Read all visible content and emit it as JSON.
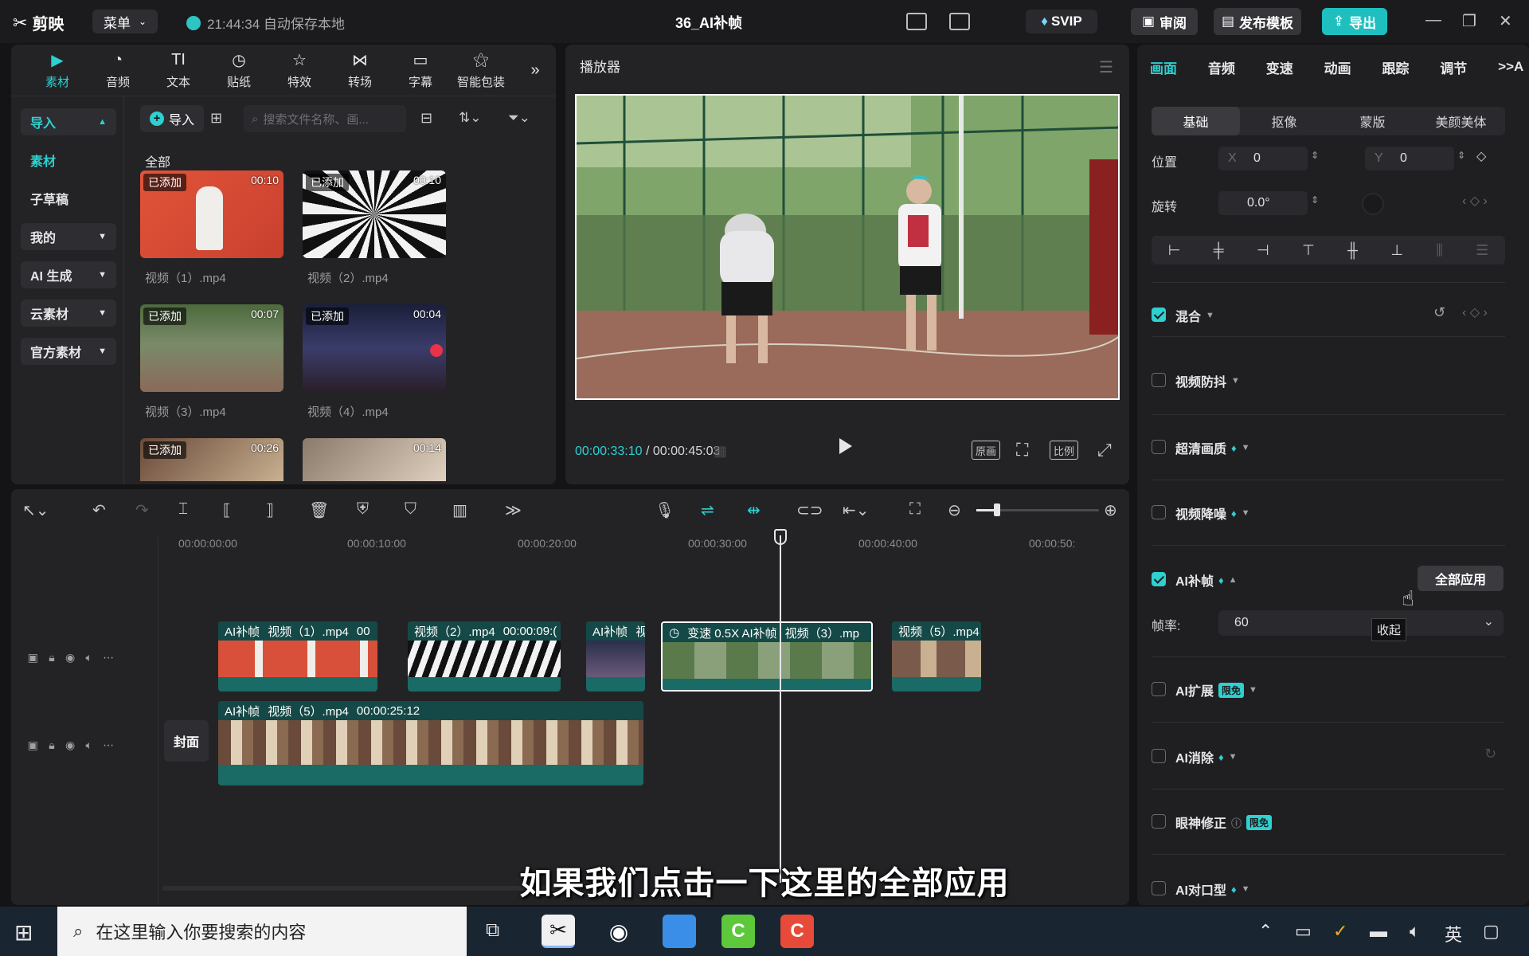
{
  "titlebar": {
    "app_name": "剪映",
    "menu_label": "菜单",
    "autosave_text": "21:44:34 自动保存本地",
    "doc_title": "36_AI补帧",
    "svip_label": "SVIP",
    "review_label": "审阅",
    "publish_label": "发布模板",
    "export_label": "导出"
  },
  "media": {
    "tabs": [
      {
        "label": "素材",
        "icon": "media-icon"
      },
      {
        "label": "音频",
        "icon": "audio-icon"
      },
      {
        "label": "文本",
        "icon": "text-icon"
      },
      {
        "label": "贴纸",
        "icon": "sticker-icon"
      },
      {
        "label": "特效",
        "icon": "effects-icon"
      },
      {
        "label": "转场",
        "icon": "transition-icon"
      },
      {
        "label": "字幕",
        "icon": "subtitle-icon"
      },
      {
        "label": "智能包装",
        "icon": "smart-pack-icon"
      }
    ],
    "nav": {
      "import": "导入",
      "material": "素材",
      "subdraft": "子草稿",
      "mine": "我的",
      "ai_gen": "AI 生成",
      "cloud": "云素材",
      "official": "官方素材"
    },
    "import_button": "导入",
    "search_placeholder": "搜索文件名称、画...",
    "all_label": "全部",
    "added_label": "已添加",
    "items": [
      {
        "name": "视频（1）.mp4",
        "duration": "00:10"
      },
      {
        "name": "视频（2）.mp4",
        "duration": "00:10"
      },
      {
        "name": "视频（3）.mp4",
        "duration": "00:07"
      },
      {
        "name": "视频（4）.mp4",
        "duration": "00:04"
      },
      {
        "name": "",
        "duration": "00:26"
      },
      {
        "name": "",
        "duration": "00:14"
      }
    ]
  },
  "player": {
    "title": "播放器",
    "current_time": "00:00:33:10",
    "total_time": "00:00:45:03",
    "original_label": "原画",
    "ratio_label": "比例"
  },
  "props": {
    "tabs": [
      "画面",
      "音频",
      "变速",
      "动画",
      "跟踪",
      "调节"
    ],
    "subtabs": [
      "基础",
      "抠像",
      "蒙版",
      "美颜美体"
    ],
    "position_label": "位置",
    "x_label": "X",
    "x_value": "0",
    "y_label": "Y",
    "y_value": "0",
    "rotate_label": "旋转",
    "rotate_value": "0.0°",
    "blend_label": "混合",
    "stabilize_label": "视频防抖",
    "hd_label": "超清画质",
    "denoise_label": "视频降噪",
    "ai_frame_label": "AI补帧",
    "apply_all_label": "全部应用",
    "fps_label": "帧率:",
    "fps_value": "60",
    "collapse_tooltip": "收起",
    "ai_expand_label": "AI扩展",
    "free_badge": "限免",
    "ai_erase_label": "AI消除",
    "eye_fix_label": "眼神修正",
    "ai_lip_label": "AI对口型",
    "accent_color": "#2ed0d0"
  },
  "timeline": {
    "ruler": [
      "00:00:00:00",
      "00:00:10:00",
      "00:00:20:00",
      "00:00:30:00",
      "00:00:40:00",
      "00:00:50:"
    ],
    "cover_label": "封面",
    "track1": [
      {
        "tag": "AI补帧",
        "name": "视频（1）.mp4",
        "dur": "00"
      },
      {
        "tag": "",
        "name": "视频（2）.mp4",
        "dur": "00:00:09:("
      },
      {
        "tag": "AI补帧",
        "name": "视",
        "dur": ""
      },
      {
        "tag": "变速 0.5X  AI补帧",
        "name": "视频（3）.mp",
        "dur": ""
      },
      {
        "tag": "",
        "name": "视频（5）.mp4",
        "dur": ""
      }
    ],
    "track2": {
      "tag": "AI补帧",
      "name": "视频（5）.mp4",
      "dur": "00:00:25:12"
    }
  },
  "subtitle_text": "如果我们点击一下这里的全部应用",
  "taskbar": {
    "search_text": "在这里输入你要搜索的内容",
    "ime": "英"
  }
}
